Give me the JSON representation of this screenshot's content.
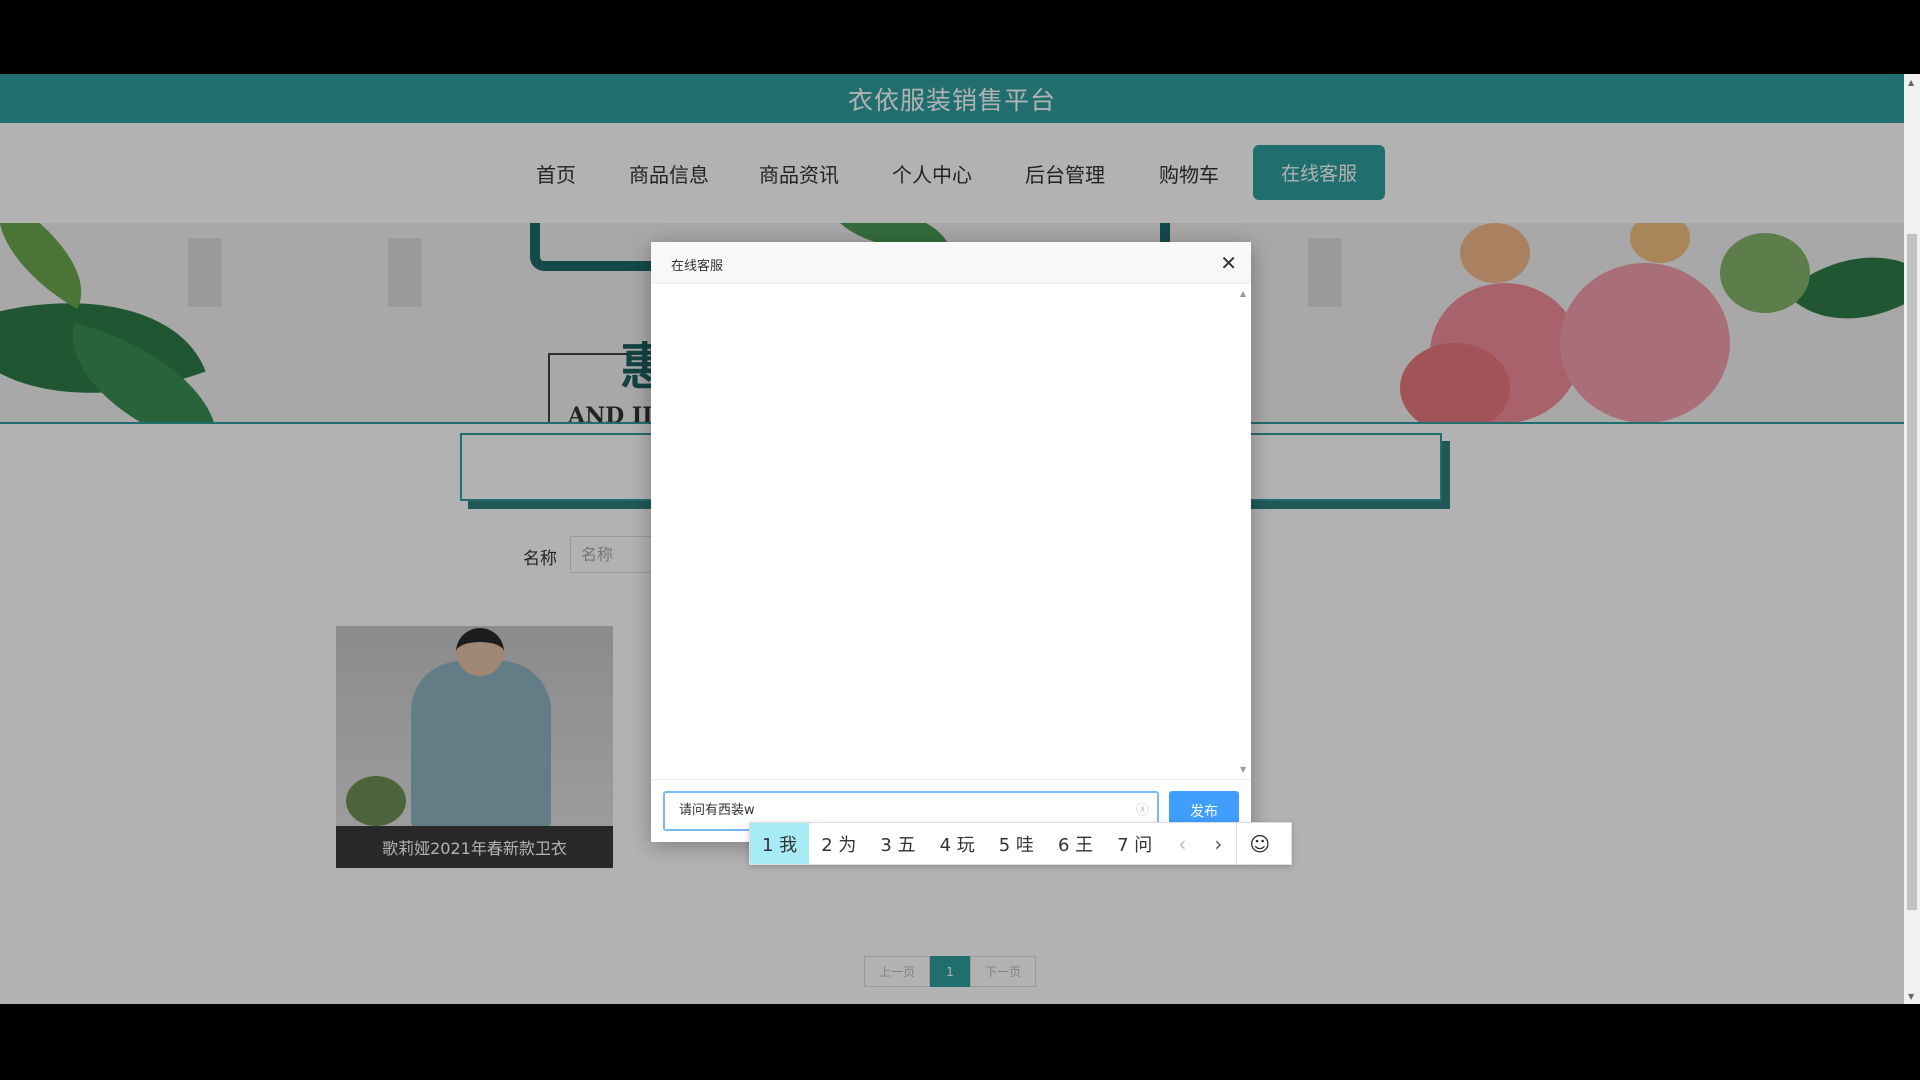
{
  "app": {
    "title": "衣依服装销售平台"
  },
  "nav": {
    "items": [
      "首页",
      "商品信息",
      "商品资讯",
      "个人中心",
      "后台管理",
      "购物车"
    ],
    "active": "在线客服"
  },
  "banner": {
    "char": "惠",
    "english": "AND II"
  },
  "filter": {
    "label": "名称",
    "placeholder": "名称"
  },
  "product": {
    "caption": "歌莉娅2021年春新款卫衣"
  },
  "pager": {
    "prev": "上一页",
    "current": "1",
    "next": "下一页"
  },
  "dialog": {
    "title": "在线客服",
    "close_glyph": "✕",
    "input_value": "请问有西装w",
    "clear_glyph": "ⓧ",
    "send_label": "发布"
  },
  "ime": {
    "candidates": [
      "1 我",
      "2 为",
      "3 五",
      "4 玩",
      "5 哇",
      "6 王",
      "7 问"
    ],
    "prev_glyph": "‹",
    "next_glyph": "›",
    "emoji_glyph": "☺"
  },
  "colors": {
    "accent": "#2e9e9e",
    "send": "#409eff",
    "ime_selected": "#a7ebf4"
  }
}
